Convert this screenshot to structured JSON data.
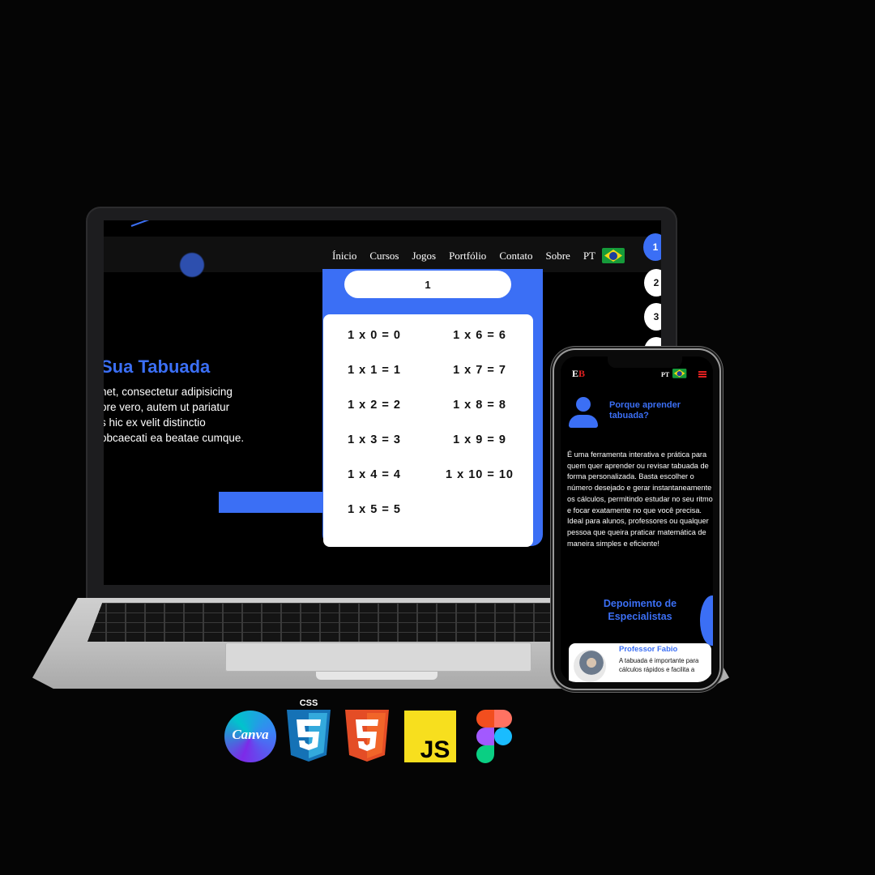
{
  "laptop": {
    "nav": [
      "Ínicio",
      "Cursos",
      "Jogos",
      "Portfólio",
      "Contato",
      "Sobre"
    ],
    "lang": "PT",
    "side_numbers": [
      "1",
      "2",
      "3"
    ],
    "hero": {
      "title": "Sua Tabuada",
      "lines": [
        "net, consectetur adipisicing",
        "ore vero, autem ut pariatur",
        "s hic ex velit distinctio",
        "obcaecati ea beatae cumque."
      ]
    },
    "tabuada": {
      "input_value": "1",
      "left": [
        "1 x 0 = 0",
        "1 x 1 = 1",
        "1 x 2 = 2",
        "1 x 3 = 3",
        "1 x 4 = 4",
        "1 x 5 = 5"
      ],
      "right": [
        "1 x 6 = 6",
        "1 x 7 = 7",
        "1 x 8 = 8",
        "1 x 9 = 9",
        "1 x 10 = 10"
      ]
    }
  },
  "phone": {
    "logo_e": "E",
    "logo_b": "B",
    "lang": "PT",
    "heading": "Porque aprender tabuada?",
    "paragraph": "É uma ferramenta interativa e prática para quem quer aprender ou revisar tabuada de forma personalizada. Basta escolher o número desejado e gerar instantaneamente os cálculos, permitindo estudar no seu ritmo e focar exatamente no que você precisa. Ideal para alunos, professores ou qualquer pessoa que queira praticar matemática de maneira simples e eficiente!",
    "section_title": "Depoimento de Especialistas",
    "testimonial": {
      "name": "Professor Fabio",
      "text": "A tabuada é importante para cálculos rápidos e facilita a"
    }
  },
  "tools": {
    "canva": "Canva",
    "css_label": "CSS",
    "js": "JS",
    "icons": [
      "canva-icon",
      "css3-icon",
      "html5-icon",
      "javascript-icon",
      "figma-icon"
    ]
  },
  "colors": {
    "accent": "#3b6ff5",
    "brand_red": "#e02020",
    "background": "#050505"
  }
}
